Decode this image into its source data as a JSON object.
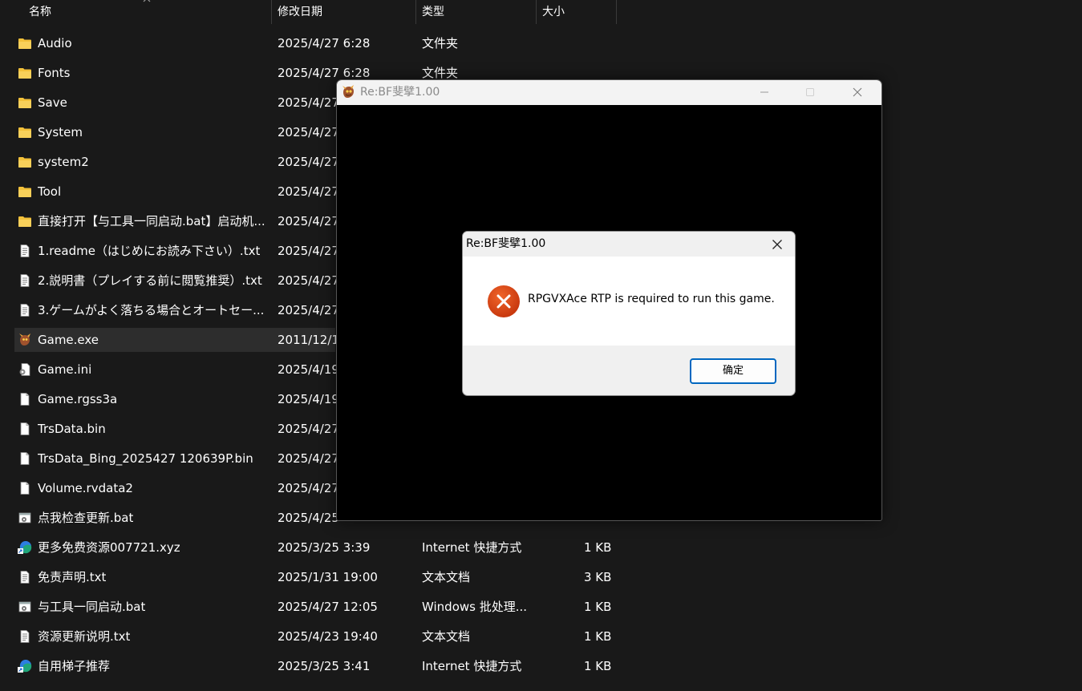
{
  "header": {
    "col_name": "名称",
    "col_modified": "修改日期",
    "col_type": "类型",
    "col_size": "大小"
  },
  "files": [
    {
      "name": "Audio",
      "date": "2025/4/27 6:28",
      "type": "文件夹",
      "size": "",
      "icon": "folder-icon"
    },
    {
      "name": "Fonts",
      "date": "2025/4/27 6:28",
      "type": "文件夹",
      "size": "",
      "icon": "folder-icon"
    },
    {
      "name": "Save",
      "date": "2025/4/27",
      "type": "",
      "size": "",
      "icon": "folder-icon"
    },
    {
      "name": "System",
      "date": "2025/4/27",
      "type": "",
      "size": "",
      "icon": "folder-icon"
    },
    {
      "name": "system2",
      "date": "2025/4/27",
      "type": "",
      "size": "",
      "icon": "folder-icon"
    },
    {
      "name": "Tool",
      "date": "2025/4/27",
      "type": "",
      "size": "",
      "icon": "folder-icon"
    },
    {
      "name": "直接打开【与工具一同启动.bat】启动机...",
      "date": "2025/4/27",
      "type": "",
      "size": "",
      "icon": "folder-icon"
    },
    {
      "name": "1.readme（はじめにお読み下さい）.txt",
      "date": "2025/4/27",
      "type": "",
      "size": "",
      "icon": "text-file-icon"
    },
    {
      "name": "2.説明書（プレイする前に閲覧推奨）.txt",
      "date": "2025/4/27",
      "type": "",
      "size": "",
      "icon": "text-file-icon"
    },
    {
      "name": "3.ゲームがよく落ちる場合とオートセー...",
      "date": "2025/4/27",
      "type": "",
      "size": "",
      "icon": "text-file-icon"
    },
    {
      "name": "Game.exe",
      "date": "2011/12/1",
      "type": "",
      "size": "",
      "icon": "game-exe-icon",
      "selected": true
    },
    {
      "name": "Game.ini",
      "date": "2025/4/19",
      "type": "",
      "size": "",
      "icon": "settings-file-icon"
    },
    {
      "name": "Game.rgss3a",
      "date": "2025/4/19",
      "type": "",
      "size": "",
      "icon": "blank-file-icon"
    },
    {
      "name": "TrsData.bin",
      "date": "2025/4/27",
      "type": "",
      "size": "",
      "icon": "blank-file-icon"
    },
    {
      "name": "TrsData_Bing_2025427 120639P.bin",
      "date": "2025/4/27",
      "type": "",
      "size": "",
      "icon": "blank-file-icon"
    },
    {
      "name": "Volume.rvdata2",
      "date": "2025/4/27",
      "type": "",
      "size": "",
      "icon": "blank-file-icon"
    },
    {
      "name": "点我检查更新.bat",
      "date": "2025/4/25",
      "type": "",
      "size": "",
      "icon": "batch-file-icon"
    },
    {
      "name": "更多免费资源007721.xyz",
      "date": "2025/3/25 3:39",
      "type": "Internet 快捷方式",
      "size": "1 KB",
      "icon": "edge-shortcut-icon"
    },
    {
      "name": "免责声明.txt",
      "date": "2025/1/31 19:00",
      "type": "文本文档",
      "size": "3 KB",
      "icon": "text-file-icon"
    },
    {
      "name": "与工具一同启动.bat",
      "date": "2025/4/27 12:05",
      "type": "Windows 批处理...",
      "size": "1 KB",
      "icon": "batch-file-icon"
    },
    {
      "name": "资源更新说明.txt",
      "date": "2025/4/23 19:40",
      "type": "文本文档",
      "size": "1 KB",
      "icon": "text-file-icon"
    },
    {
      "name": "自用梯子推荐",
      "date": "2025/3/25 3:41",
      "type": "Internet 快捷方式",
      "size": "1 KB",
      "icon": "edge-shortcut-icon"
    }
  ],
  "game_window": {
    "title": "Re:BF斐擘1.00"
  },
  "dialog": {
    "title": "Re:BF斐擘1.00",
    "message": "RPGVXAce RTP is required to run this game.",
    "ok_label": "确定",
    "icon": "error-icon"
  },
  "colors": {
    "background": "#191919",
    "selected_row": "#2d2d2d",
    "folder": "#f3c13a",
    "error": "#e0491a",
    "accent": "#0067c0"
  }
}
